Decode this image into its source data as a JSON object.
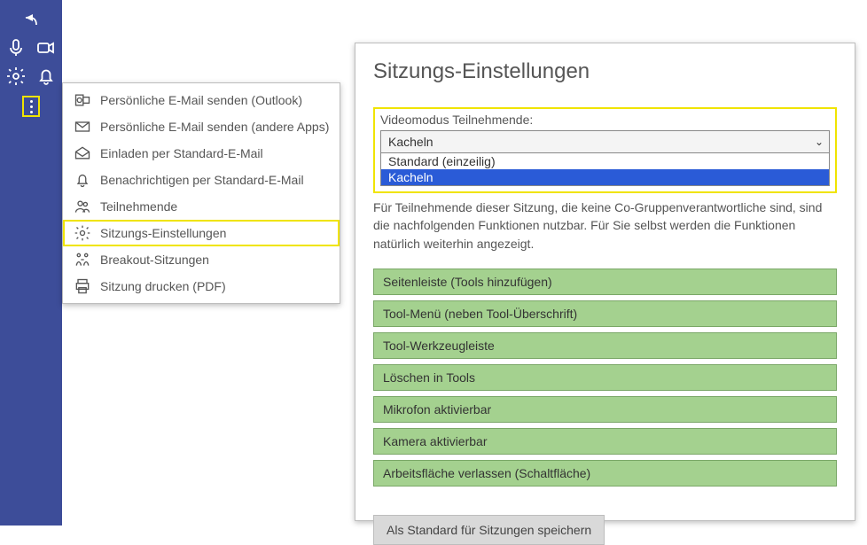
{
  "sidebar_icons": {
    "undo": "undo-icon",
    "mic": "mic-icon",
    "cam": "camera-icon",
    "gear": "gear-icon",
    "bell": "bell-icon",
    "more": "more-icon"
  },
  "flyout": {
    "items": [
      {
        "id": "outlook",
        "label": "Persönliche E-Mail senden (Outlook)"
      },
      {
        "id": "otherapps",
        "label": "Persönliche E-Mail senden (andere Apps)"
      },
      {
        "id": "invite",
        "label": "Einladen per Standard-E-Mail"
      },
      {
        "id": "notify",
        "label": "Benachrichtigen per Standard-E-Mail"
      },
      {
        "id": "people",
        "label": "Teilnehmende"
      },
      {
        "id": "settings",
        "label": "Sitzungs-Einstellungen"
      },
      {
        "id": "breakout",
        "label": "Breakout-Sitzungen"
      },
      {
        "id": "print",
        "label": "Sitzung drucken (PDF)"
      }
    ],
    "highlighted": "settings"
  },
  "panel": {
    "title": "Sitzungs-Einstellungen",
    "videomode": {
      "label": "Videomodus Teilnehmende:",
      "selected": "Kacheln",
      "options": [
        "Standard (einzeilig)",
        "Kacheln"
      ],
      "open_selected_index": 1
    },
    "description": "Für Teilnehmende dieser Sitzung, die keine Co-Gruppenverantwortliche sind, sind die nachfolgenden Funktionen nutzbar. Für Sie selbst werden die Funktionen natürlich weiterhin angezeigt.",
    "functions": [
      "Seitenleiste (Tools hinzufügen)",
      "Tool-Menü (neben Tool-Überschrift)",
      "Tool-Werkzeugleiste",
      "Löschen in Tools",
      "Mikrofon aktivierbar",
      "Kamera aktivierbar",
      "Arbeitsfläche verlassen (Schaltfläche)"
    ],
    "save_label": "Als Standard für Sitzungen speichern"
  }
}
